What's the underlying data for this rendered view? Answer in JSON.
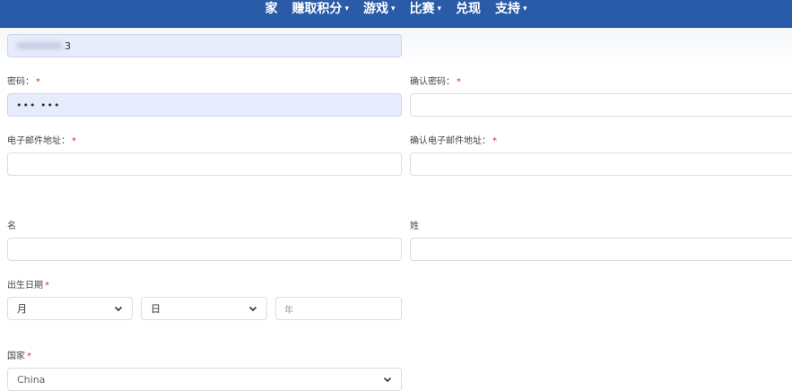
{
  "nav": {
    "items": [
      {
        "label": "家",
        "caret": false
      },
      {
        "label": "赚取积分",
        "caret": true
      },
      {
        "label": "游戏",
        "caret": true
      },
      {
        "label": "比赛",
        "caret": true
      },
      {
        "label": "兑现",
        "caret": false
      },
      {
        "label": "支持",
        "caret": true
      }
    ],
    "caret_glyph": "▾",
    "bg_color": "#2a5ba8"
  },
  "form": {
    "username": {
      "value_suffix": "3"
    },
    "password": {
      "label": "密码：",
      "required": "*",
      "value": "•••  •••"
    },
    "confirm_password": {
      "label": "确认密码：",
      "required": "*",
      "value": ""
    },
    "email": {
      "label": "电子邮件地址：",
      "required": "*",
      "value": ""
    },
    "confirm_email": {
      "label": "确认电子邮件地址：",
      "required": "*",
      "value": ""
    },
    "first_name": {
      "label": "名",
      "value": ""
    },
    "last_name": {
      "label": "姓",
      "value": ""
    },
    "dob": {
      "label": "出生日期",
      "required": "*",
      "month": "月",
      "day": "日",
      "year_placeholder": "年"
    },
    "country": {
      "label": "国家",
      "required": "*",
      "value": "China"
    }
  },
  "colors": {
    "required": "#d93025",
    "filled_bg": "#e6ecfb"
  }
}
